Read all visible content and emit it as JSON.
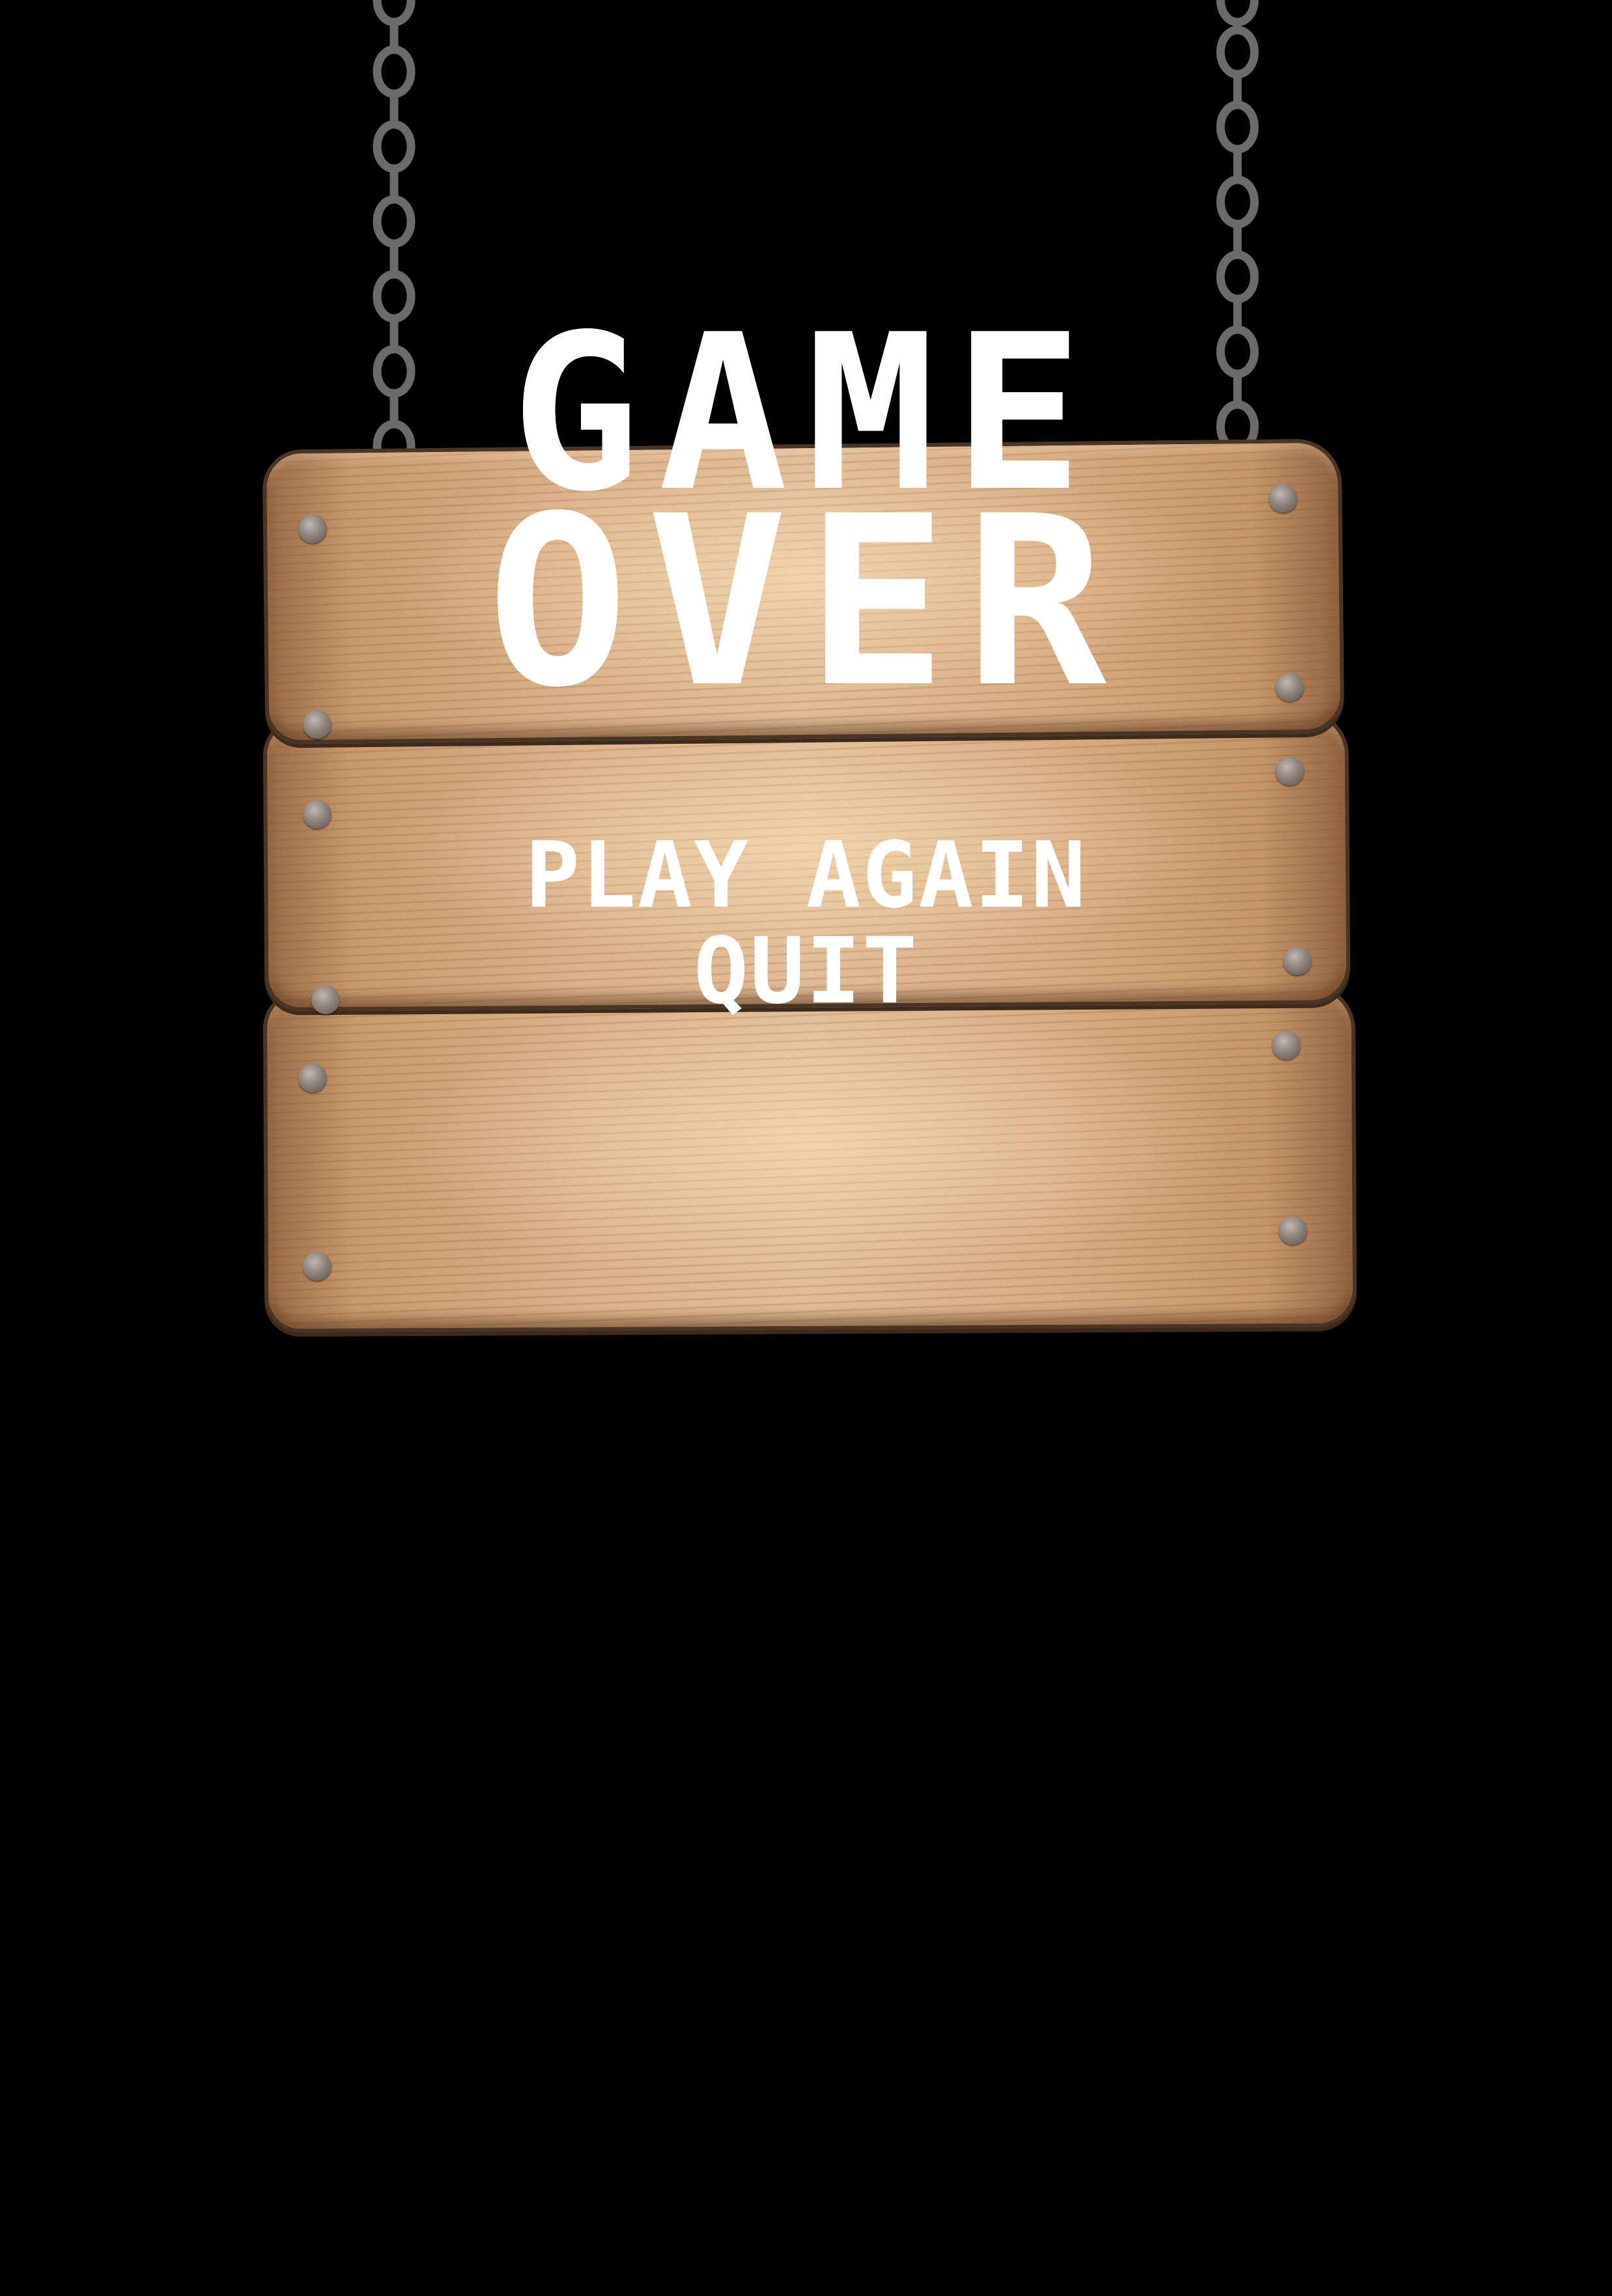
{
  "title": {
    "line1": "GAME",
    "line2": "OVER"
  },
  "menu": {
    "play_again": "PLAY AGAIN",
    "quit": "QUIT"
  },
  "colors": {
    "background": "#000000",
    "text": "#ffffff",
    "chain": "#6b6b6b",
    "wood": "#d9ae84"
  }
}
